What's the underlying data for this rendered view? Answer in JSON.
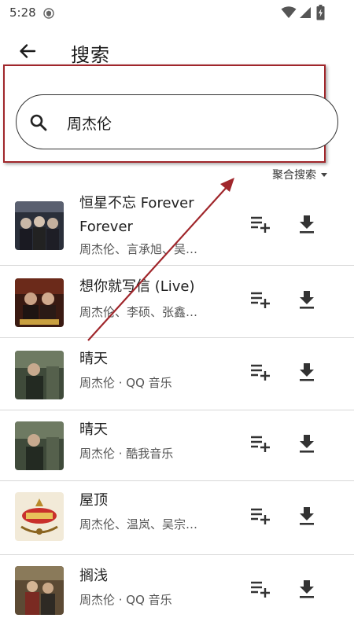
{
  "status_bar": {
    "time": "5:28",
    "icons": [
      "shield-icon",
      "wifi-icon",
      "signal-icon",
      "battery-icon"
    ]
  },
  "header": {
    "back_icon": "arrow-left-icon",
    "title": "搜索"
  },
  "search": {
    "value": "周杰伦",
    "icon": "search-icon"
  },
  "source_selector": {
    "label": "聚合搜索",
    "icon": "caret-down-icon"
  },
  "results": [
    {
      "title": "恒星不忘 Forever Forever",
      "subtitle": "周杰伦、言承旭、吴…"
    },
    {
      "title": "想你就写信 (Live)",
      "subtitle": "周杰伦、李硕、张鑫…"
    },
    {
      "title": "晴天",
      "subtitle": "周杰伦 · QQ 音乐"
    },
    {
      "title": "晴天",
      "subtitle": "周杰伦 · 酷我音乐"
    },
    {
      "title": "屋顶",
      "subtitle": "周杰伦、温岚、吴宗…"
    },
    {
      "title": "搁浅",
      "subtitle": "周杰伦 · QQ 音乐"
    }
  ],
  "row_actions": {
    "queue_icon": "playlist-add-icon",
    "download_icon": "download-icon"
  },
  "annotation": {
    "highlight_color": "#a0262b",
    "arrow_color": "#a0262b"
  }
}
